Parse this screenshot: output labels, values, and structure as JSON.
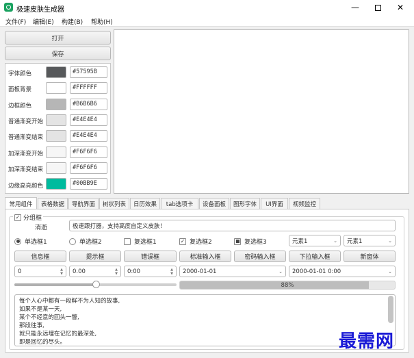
{
  "window": {
    "title": "极速皮肤生成器",
    "min_icon": "minimize-icon",
    "max_icon": "maximize-icon",
    "close_icon": "close-icon"
  },
  "menu": [
    "文件(F)",
    "编辑(E)",
    "构建(B)",
    "帮助(H)"
  ],
  "left_buttons": {
    "open": "打开",
    "save": "保存"
  },
  "colors": [
    {
      "label": "字体颜色",
      "hex": "#57595B"
    },
    {
      "label": "面板背景",
      "hex": "#FFFFFF"
    },
    {
      "label": "边框颜色",
      "hex": "#B6B6B6"
    },
    {
      "label": "普通渐变开始",
      "hex": "#E4E4E4"
    },
    {
      "label": "普通渐变结束",
      "hex": "#E4E4E4"
    },
    {
      "label": "加深渐变开始",
      "hex": "#F6F6F6"
    },
    {
      "label": "加深渐变结束",
      "hex": "#F6F6F6"
    },
    {
      "label": "边缘高亮颜色",
      "hex": "#00BB9E"
    }
  ],
  "tabs": [
    "常用组件",
    "表格数据",
    "导航界面",
    "树状列表",
    "日历效果",
    "tab选项卡",
    "设备面板",
    "图形字体",
    "UI界面",
    "视频监控"
  ],
  "group": {
    "title": "分组框",
    "message_label": "消逝",
    "message_value": "极速跟打器，支持高度自定义皮肤！",
    "radio1": "单选框1",
    "radio2": "单选框2",
    "check1": "复选框1",
    "check2": "复选框2",
    "check3": "复选框3",
    "combo1": "元素1",
    "combo2": "元素1",
    "buttons": [
      "信息框",
      "提示框",
      "错误框",
      "标准输入框",
      "密码输入框",
      "下拉输入框",
      "新窗体"
    ],
    "spin_int": "0",
    "spin_double": "0.00",
    "time": "0:00",
    "date": "2000-01-01",
    "datetime": "2000-01-01 0:00",
    "slider_value": 0.5,
    "progress": 88,
    "progress_text": "88%",
    "text_lines": [
      "每个人心中都有一段鲜不为人知的故事,",
      "如果不是某一天,",
      "某个不经意的回头一瞥,",
      "那段往事,",
      "就只能永远埋在记忆的最深处,",
      "即是回忆的尽头。"
    ]
  },
  "watermark": "最需网",
  "accent": "#00BB9E"
}
